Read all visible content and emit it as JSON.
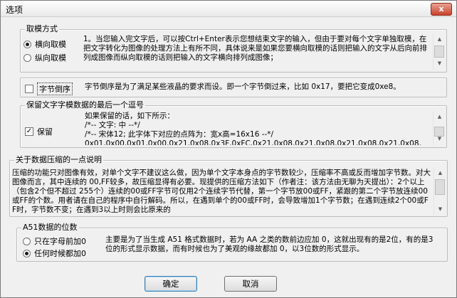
{
  "window": {
    "title": "选项",
    "close_glyph": "x"
  },
  "group_mode": {
    "legend": "取模方式",
    "options": [
      "横向取模",
      "纵向取模"
    ],
    "selected": "横向取模",
    "description": "1。当您输入完文字后，可以按Ctrl+Enter表示您想结束文字的输入，但由于要对每个文字单独取模，在把文字转化为图像的处理方法上有所不同，具体说来是如果您要横向取模的话则把输入的文字从后向前排列成图像而纵向取模的话则把输入的文字横向排列成图像；"
  },
  "group_byte_reverse": {
    "checkbox_label": "字节倒序",
    "checked": false,
    "description": "字节倒序是为了满足某些液晶的要求而设。即一个字节倒过来，比如 0x17，要把它变成0xe8。"
  },
  "group_keep_comma": {
    "legend": "保留文字字模数据的最后一个逗号",
    "checkbox_label": "保留",
    "checked": true,
    "sample_lines": [
      "如果保留的话，如下所示：",
      "/*--  文字:  中  --*/",
      "/*--  宋体12;  此字体下对应的点阵为：宽x高=16x16   --*/",
      "0x01,0x00,0x01,0x00,0x21,0x08,0x3F,0xFC,0x21,0x08,0x21,0x08,0x21,0x08,0x21,0x08,"
    ]
  },
  "group_compression": {
    "legend": "关于数据压缩的一点说明",
    "text": "压缩的功能只对图像有效，对单个文字不建议这么做，因为单个文字本身点的字节数较少，压缩率不高或反而增加字节数。对大图像而言，其中连续的 00,FF较多，故压缩显得有必要。现提供的压缩方法如下（作者注：该方法由无聊为天提出）：2个以上（包含2个但不超过 255个）连续的00或FF字节可仅用2个连续字节代替，第一个字节放00或FF，紧跟的第二个字节放连续00或FF的个数。用者请在自己的程序中自行解码。所以，在遇到单个的00或FF时，会导致增加1个字节数；在遇到连续2个00或FF时，字节数不变；在遇到3以上时则会比原来的"
  },
  "group_a51": {
    "legend": "A51数据的位数",
    "options": [
      "只在字母前加0",
      "任何时候都加0"
    ],
    "selected": "任何时候都加0",
    "description": "主要是为了当生成 A51 格式数据时，若为 AA 之类的数前边应加 0，这就出现有的是2位，有的是3位的形式显示数据，而有时候也为了美观的缘故都加 0，以3位数的形式显示。"
  },
  "buttons": {
    "ok": "确定",
    "cancel": "取消"
  }
}
